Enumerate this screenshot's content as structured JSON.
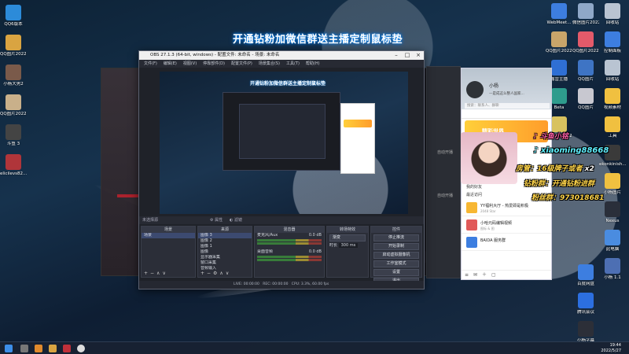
{
  "banner": "开通钻粉加微信群送主播定制鼠标垫",
  "desktop": {
    "left_icons": [
      {
        "label": "QQ6版本",
        "icon": "qq-icon",
        "color": "#2c8bd9"
      },
      {
        "label": "QQ图片20220506...",
        "icon": "image-icon",
        "color": "#d9a441"
      },
      {
        "label": "小杨大男2",
        "icon": "image-icon",
        "color": "#7a5a4a"
      },
      {
        "label": "QQ图片20220515...",
        "icon": "image-icon",
        "color": "#c9b08a"
      },
      {
        "label": "斗鱼 3",
        "icon": "app-icon",
        "color": "#444"
      },
      {
        "label": "elicilevs82...",
        "icon": "image-icon",
        "color": "#b0353a"
      }
    ],
    "right_col1": [
      {
        "label": "WebMeet...",
        "icon": "meeting-icon",
        "color": "#3d7ee0"
      },
      {
        "label": "QQ图片20220510...",
        "icon": "image-icon",
        "color": "#c9a56a"
      },
      {
        "label": "露营主播",
        "icon": "app-icon",
        "color": "#2f6fd4"
      },
      {
        "label": "Beta",
        "icon": "app-icon",
        "color": "#2e9c8d"
      },
      {
        "label": "QQ图片20220519...",
        "icon": "image-icon",
        "color": "#d8c25f"
      }
    ],
    "right_col2": [
      {
        "label": "微信图片20220510...",
        "icon": "image-icon",
        "color": "#8fa8c8"
      },
      {
        "label": "QQ图片20221204...",
        "icon": "image-icon",
        "color": "#e35a6a"
      },
      {
        "label": "QQ图片",
        "icon": "image-icon",
        "color": "#3e74c4"
      },
      {
        "label": "QQ图片",
        "icon": "image-icon",
        "color": "#c8c8d0"
      }
    ],
    "right_col3": [
      {
        "label": "回收站",
        "icon": "recycle-bin-icon",
        "color": "#b9c4d2"
      },
      {
        "label": "控制面板",
        "icon": "control-panel-icon",
        "color": "#3d7ee0"
      },
      {
        "label": "回收站",
        "icon": "recycle-bin-icon",
        "color": "#b9c4d2"
      },
      {
        "label": "视频素材",
        "icon": "folder-icon",
        "color": "#f0c040"
      },
      {
        "label": "工具",
        "icon": "folder-icon",
        "color": "#f0c040"
      },
      {
        "label": "ekonkinish...",
        "icon": "app-icon",
        "color": "#3a3a3a"
      },
      {
        "label": "小杨图片",
        "icon": "folder-icon",
        "color": "#f0c040"
      },
      {
        "label": "Nexus",
        "icon": "app-icon",
        "color": "#2a2f3a"
      },
      {
        "label": "此电脑",
        "icon": "computer-icon",
        "color": "#4a8ce0"
      },
      {
        "label": "小杨 1.1",
        "icon": "image-icon",
        "color": "#4d6fb3"
      }
    ],
    "right_bottom": [
      {
        "label": "百度网盘",
        "icon": "cloud-icon",
        "color": "#3d7ee0"
      },
      {
        "label": "腾讯会议",
        "icon": "meeting-icon",
        "color": "#2c6fe0"
      },
      {
        "label": "小杨字幕",
        "icon": "app-icon",
        "color": "#2c2f38"
      }
    ]
  },
  "obs": {
    "title": "OBS 27.1.3 (64-bit, windows) - 配置文件: 未命名 - 场景: 未命名",
    "menu": [
      "文件(F)",
      "编辑(E)",
      "视图(V)",
      "停靠部件(D)",
      "配置文件(P)",
      "场景集合(S)",
      "工具(T)",
      "帮助(H)"
    ],
    "preview_caption": "开通钻粉加微信群送主播定制鼠标垫",
    "scene_bar": "未选择源",
    "scene_bar_buttons": [
      "属性",
      "滤镜"
    ],
    "docks": {
      "scenes": {
        "header": "场景",
        "items": [
          "场景"
        ]
      },
      "sources": {
        "header": "来源",
        "items": [
          "图像 3",
          "图像 2",
          "图像 1",
          "图像",
          "显示器采集",
          "窗口采集",
          "音频输入"
        ]
      },
      "mixer": {
        "header": "混音器",
        "channels": [
          {
            "name": "麦克风/Aux",
            "db": "0.0 dB"
          },
          {
            "name": "桌面音频",
            "db": "0.0 dB"
          }
        ]
      },
      "transitions": {
        "header": "转场特效",
        "type": "渐变",
        "duration_label": "时长",
        "duration": "300 ms"
      },
      "controls": {
        "header": "控件",
        "buttons": [
          "停止推流",
          "开始录制",
          "启动虚拟摄像机",
          "工作室模式",
          "设置",
          "退出"
        ]
      }
    },
    "status": {
      "dropped": "丢弃的帧 0 (0.0%)",
      "live": "LIVE: 00:00:00",
      "rec": "REC: 00:00:00",
      "cpu": "CPU: 3.3%, 60.00 fps",
      "kbps": "kb/s"
    }
  },
  "side_panel": {
    "label1": "自动开播",
    "label2": "自动开播"
  },
  "qq": {
    "name": "小杨",
    "signature": "—是成这么整人国家...",
    "search_placeholder": "搜索：联系人、群聊",
    "banner_title": "精彩世界",
    "list": [
      "我的资源",
      "我的好友",
      "最近访问"
    ],
    "messages": [
      {
        "title": "YY福利大厅 - 热爱即是积极",
        "sub": "2048 Star",
        "color": "#f7b733"
      },
      {
        "title": "小哈元码编辑视频",
        "sub": "图标 & 图",
        "color": "#e15a5a"
      },
      {
        "title": "BAIDA 服务群",
        "sub": "",
        "color": "#3d7ee0"
      }
    ]
  },
  "overlay": {
    "douyin_label": "斗鱼小铭",
    "tiktok_id": "xiaoming88668",
    "line1": "房管：16级牌子或者",
    "line1_badge": "x2",
    "line2": "钻粉群：开通钻粉进群",
    "line3": "粉丝群：973018681",
    "colors": {
      "pink": "#ff5fa8",
      "cyan": "#5ff0ff",
      "yellow": "#ffd54a"
    }
  },
  "taskbar": {
    "time": "19:44",
    "date": "2022/5/27"
  }
}
